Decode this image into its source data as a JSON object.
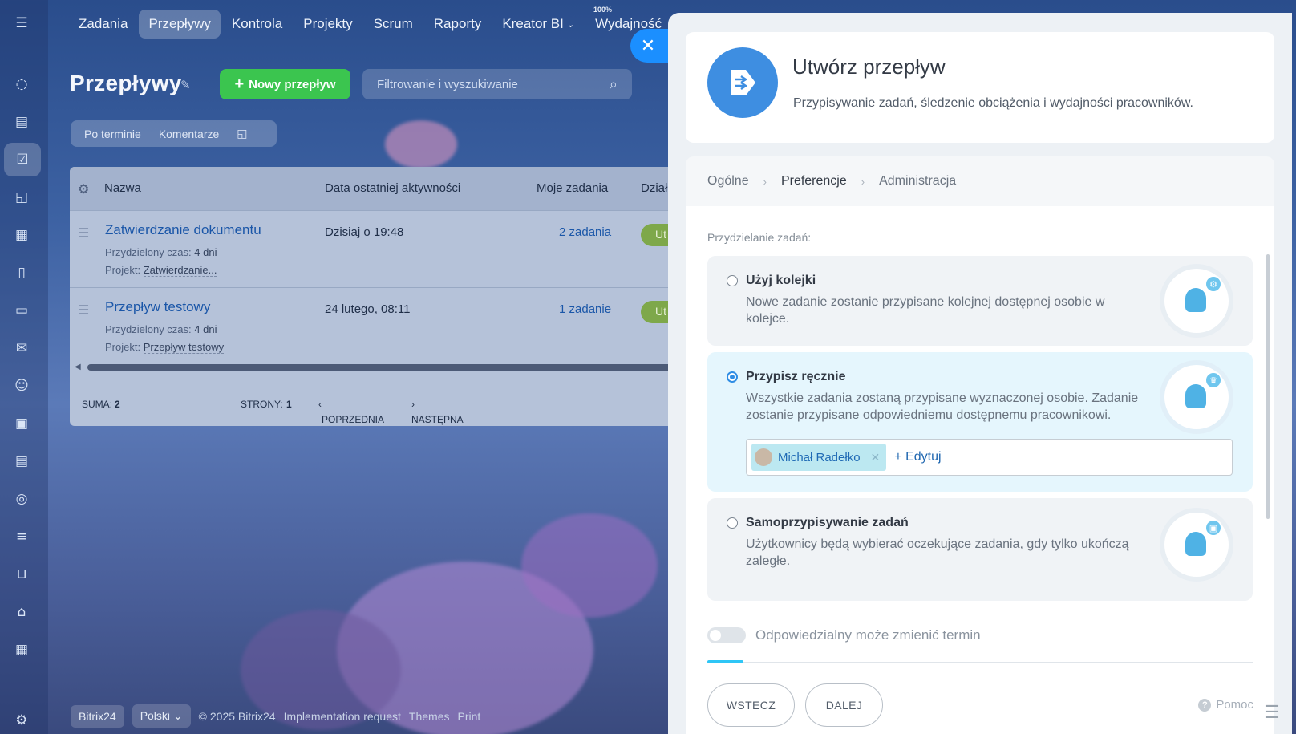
{
  "topnav": {
    "items": [
      "Zadania",
      "Przepływy",
      "Kontrola",
      "Projekty",
      "Scrum",
      "Raporty",
      "Kreator BI",
      "Wydajność"
    ],
    "active_index": 1,
    "percent": "100%"
  },
  "sidebar": {
    "icons": [
      "hamburger-icon",
      "feed-icon",
      "tasks-list-icon",
      "checkbox-icon",
      "chat-icon",
      "calendar-icon",
      "document-icon",
      "drive-icon",
      "mail-icon",
      "contacts-icon",
      "presentation-icon",
      "news-icon",
      "target-icon",
      "filter-icon",
      "cart-icon",
      "warehouse-icon",
      "schedule-icon",
      "settings-icon"
    ]
  },
  "page": {
    "title": "Przepływy",
    "new_button": "Nowy przepływ",
    "search_placeholder": "Filtrowanie i wyszukiwanie",
    "filters": [
      "Po terminie",
      "Komentarze"
    ]
  },
  "grid": {
    "columns": [
      "Nazwa",
      "Data ostatniej aktywności",
      "Moje zadania",
      "Dział"
    ],
    "rows": [
      {
        "title": "Zatwierdzanie dokumentu",
        "time_label": "Przydzielony czas:",
        "time_value": "4 dni",
        "project_label": "Projekt:",
        "project_value": "Zatwierdzanie...",
        "date": "Dzisiaj o 19:48",
        "count": "2 zadania",
        "pill": "Ut"
      },
      {
        "title": "Przepływ testowy",
        "time_label": "Przydzielony czas:",
        "time_value": "4 dni",
        "project_label": "Projekt:",
        "project_value": "Przepływ testowy",
        "date": "24 lutego, 08:11",
        "count": "1 zadanie",
        "pill": "Ut"
      }
    ],
    "footer": {
      "sum_label": "SUMA:",
      "sum_value": "2",
      "pages_label": "STRONY:",
      "pages_value": "1",
      "prev": "POPRZEDNIA",
      "next": "NASTĘPNA"
    }
  },
  "bottom_footer": {
    "brand": "Bitrix24",
    "language": "Polski",
    "copyright": "© 2025 Bitrix24",
    "links": [
      "Implementation request",
      "Themes",
      "Print"
    ]
  },
  "panel": {
    "title": "Utwórz przepływ",
    "subtitle": "Przypisywanie zadań, śledzenie obciążenia i wydajności pracowników.",
    "steps": [
      "Ogólne",
      "Preferencje",
      "Administracja"
    ],
    "active_step": 1,
    "section_label": "Przydzielanie zadań:",
    "options": [
      {
        "title": "Użyj kolejki",
        "desc": "Nowe zadanie zostanie przypisane kolejnej dostępnej osobie w kolejce.",
        "selected": false
      },
      {
        "title": "Przypisz ręcznie",
        "desc": "Wszystkie zadania zostaną przypisane wyznaczonej osobie. Zadanie zostanie przypisane odpowiedniemu dostępnemu pracownikowi.",
        "selected": true
      },
      {
        "title": "Samoprzypisywanie zadań",
        "desc": "Użytkownicy będą wybierać oczekujące zadania, gdy tylko ukończą zaległe.",
        "selected": false
      }
    ],
    "assignee": "Michał Radełko",
    "edit_label": "+ Edytuj",
    "toggle_label": "Odpowiedzialny może zmienić termin",
    "back_button": "WSTECZ",
    "next_button": "DALEJ",
    "help": "Pomoc"
  }
}
